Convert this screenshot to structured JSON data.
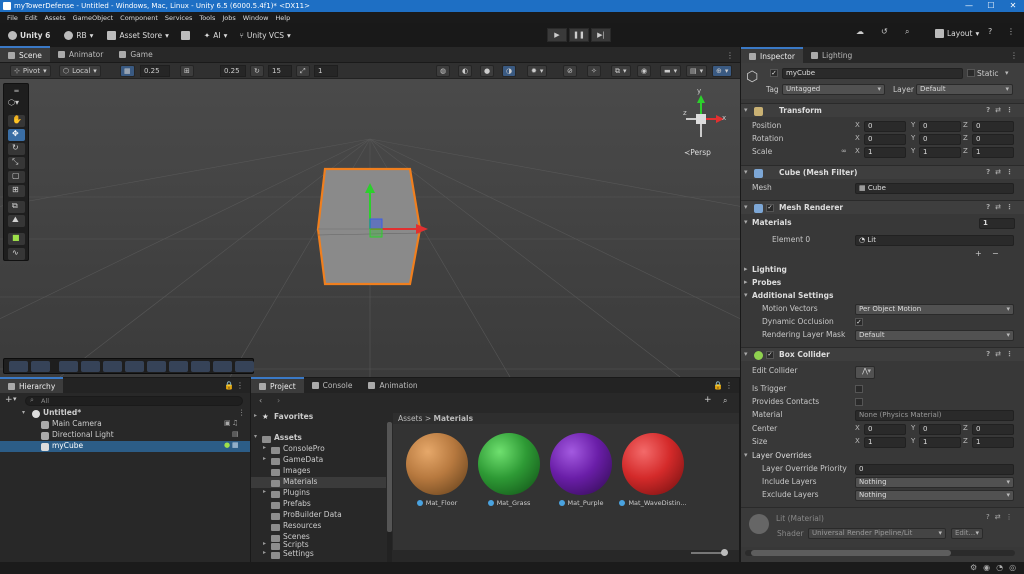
{
  "window": {
    "title": "myTowerDefense - Untitled - Windows, Mac, Linux - Unity 6.5 (6000.5.4f1)* <DX11>",
    "controls": [
      "—",
      "☐",
      "✕"
    ]
  },
  "menu": [
    "File",
    "Edit",
    "Assets",
    "GameObject",
    "Component",
    "Services",
    "Tools",
    "Jobs",
    "Window",
    "Help"
  ],
  "toolbar": {
    "unity": "Unity 6",
    "account": "RB",
    "asset_store": "Asset Store",
    "ai": "AI",
    "vcs": "Unity VCS",
    "layout": "Layout"
  },
  "scene_tabs": [
    {
      "label": "Scene",
      "icon": "scene-icon"
    },
    {
      "label": "Animator",
      "icon": "animator-icon"
    },
    {
      "label": "Game",
      "icon": "game-icon"
    }
  ],
  "scene_options": {
    "pivot": "Pivot",
    "local": "Local",
    "grid_size": "0.25",
    "snap_value": "0.25",
    "rotate_snap": "15",
    "scale_snap": "1"
  },
  "viewport": {
    "persp": "≺Persp",
    "axis_y": "y",
    "axis_x": "x",
    "axis_z": "z"
  },
  "inspector": {
    "tabs": [
      "Inspector",
      "Lighting"
    ],
    "object_name": "myCube",
    "static_label": "Static",
    "tag_label": "Tag",
    "tag_value": "Untagged",
    "layer_label": "Layer",
    "layer_value": "Default",
    "transform": {
      "title": "Transform",
      "rows": [
        {
          "label": "Position",
          "x": "0",
          "y": "0",
          "z": "0"
        },
        {
          "label": "Rotation",
          "x": "0",
          "y": "0",
          "z": "0"
        },
        {
          "label": "Scale",
          "x": "1",
          "y": "1",
          "z": "1"
        }
      ]
    },
    "mesh_filter": {
      "title": "Cube (Mesh Filter)",
      "mesh_label": "Mesh",
      "mesh_value": "Cube"
    },
    "mesh_renderer": {
      "title": "Mesh Renderer",
      "materials_label": "Materials",
      "materials_count": "1",
      "element_label": "Element 0",
      "element_value": "Lit",
      "add": "+",
      "remove": "−",
      "lighting": "Lighting",
      "probes": "Probes",
      "additional": "Additional Settings",
      "motion_label": "Motion Vectors",
      "motion_value": "Per Object Motion",
      "dynamic_label": "Dynamic Occlusion",
      "rlm_label": "Rendering Layer Mask",
      "rlm_value": "Default"
    },
    "box_collider": {
      "title": "Box Collider",
      "edit_label": "Edit Collider",
      "trigger_label": "Is Trigger",
      "contacts_label": "Provides Contacts",
      "material_label": "Material",
      "material_value": "None (Physics Material)",
      "center_label": "Center",
      "center": {
        "x": "0",
        "y": "0",
        "z": "0"
      },
      "size_label": "Size",
      "size": {
        "x": "1",
        "y": "1",
        "z": "1"
      },
      "overrides": "Layer Overrides",
      "priority_label": "Layer Override Priority",
      "priority_value": "0",
      "include_label": "Include Layers",
      "include_value": "Nothing",
      "exclude_label": "Exclude Layers",
      "exclude_value": "Nothing"
    },
    "lit": {
      "title": "Lit (Material)",
      "shader_label": "Shader",
      "shader_value": "Universal Render Pipeline/Lit",
      "edit": "Edit..."
    }
  },
  "hierarchy": {
    "tab": "Hierarchy",
    "search_placeholder": "All",
    "scene": "Untitled*",
    "items": [
      "Main Camera",
      "Directional Light",
      "myCube"
    ]
  },
  "project": {
    "tabs": [
      "Project",
      "Console",
      "Animation"
    ],
    "favorites": "Favorites",
    "assets": "Assets",
    "folders": [
      "ConsolePro",
      "GameData",
      "Images",
      "Materials",
      "Plugins",
      "Prefabs",
      "ProBuilder Data",
      "Resources",
      "Scenes",
      "Scripts",
      "Settings"
    ],
    "breadcrumb_root": "Assets",
    "breadcrumb_sep": ">",
    "breadcrumb_leaf": "Materials",
    "materials": [
      {
        "name": "Mat_Floor",
        "color": "#b7793f"
      },
      {
        "name": "Mat_Grass",
        "color": "#2e9a35"
      },
      {
        "name": "Mat_Purple",
        "color": "#6a1ea8"
      },
      {
        "name": "Mat_WaveDistin...",
        "color": "#d42a2a"
      }
    ],
    "search_placeholder": ""
  }
}
